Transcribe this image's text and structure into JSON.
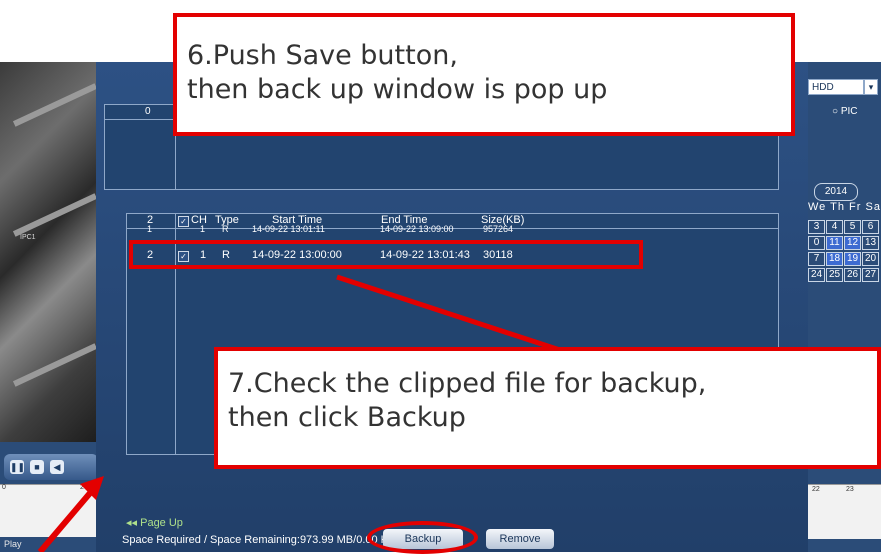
{
  "left_video": {
    "camera_label": "IPC1"
  },
  "playback": {
    "controls": [
      "pause",
      "stop",
      "rewind"
    ],
    "timeline_ticks": [
      "0",
      "2"
    ],
    "mode_label": "Play"
  },
  "top_list": {
    "count_header": "0"
  },
  "file_list": {
    "count_header": "2",
    "columns": [
      "CH",
      "Type",
      "Start Time",
      "End Time",
      "Size(KB)"
    ],
    "rows": [
      {
        "index": "1",
        "checked": true,
        "ch": "1",
        "type": "R",
        "start": "14-09-22 13:01:11",
        "end": "14-09-22 13:09:00",
        "size": "957264"
      },
      {
        "index": "2",
        "checked": true,
        "ch": "1",
        "type": "R",
        "start": "14-09-22 13:00:00",
        "end": "14-09-22 13:01:43",
        "size": "30118"
      }
    ]
  },
  "footer": {
    "page_up": "Page Up",
    "space_info": "Space Required / Space Remaining:973.99 MB/0.00 KB",
    "backup_label": "Backup",
    "remove_label": "Remove"
  },
  "right_panel": {
    "device": "HDD",
    "pic_option": "PIC",
    "year": "2014",
    "weekday_header": "We Th Fr Sa",
    "calendar_rows": [
      [
        "3",
        "4",
        "5",
        "6"
      ],
      [
        "0",
        "11",
        "12",
        "13"
      ],
      [
        "7",
        "18",
        "19",
        "20"
      ],
      [
        "24",
        "25",
        "26",
        "27"
      ]
    ],
    "highlighted_days": [
      "11",
      "12",
      "18",
      "19"
    ],
    "timeline_ticks": [
      "22",
      "23"
    ]
  },
  "callouts": {
    "step6_line1": "6.Push Save button,",
    "step6_line2": "then back up window is pop up",
    "step7_line1": "7.Check the clipped file for backup,",
    "step7_line2": "then click Backup"
  },
  "colors": {
    "annotation_red": "#e30000",
    "dialog_blue": "#2d5184",
    "highlight_blue": "#3d6bd1"
  }
}
